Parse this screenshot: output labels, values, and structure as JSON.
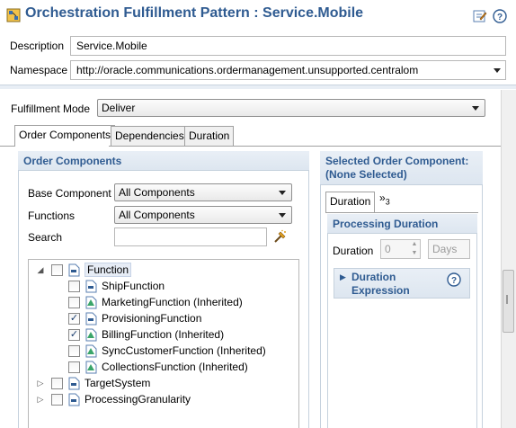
{
  "header": {
    "title": "Orchestration Fulfillment Pattern : Service.Mobile"
  },
  "form": {
    "description_label": "Description",
    "description_value": "Service.Mobile",
    "namespace_label": "Namespace",
    "namespace_value": "http://oracle.communications.ordermanagement.unsupported.centralom"
  },
  "fulfillment_mode": {
    "label": "Fulfillment Mode",
    "value": "Deliver"
  },
  "tabs": [
    {
      "label": "Order Components"
    },
    {
      "label": "Dependencies"
    },
    {
      "label": "Duration"
    }
  ],
  "order_components": {
    "heading": "Order Components",
    "base_component_label": "Base Component",
    "base_component_value": "All Components",
    "functions_label": "Functions",
    "functions_value": "All Components",
    "search_label": "Search",
    "tree": [
      {
        "label": "Function",
        "checked": false
      },
      {
        "label": "ShipFunction",
        "checked": false
      },
      {
        "label": "MarketingFunction (Inherited)",
        "checked": false
      },
      {
        "label": "ProvisioningFunction",
        "checked": true
      },
      {
        "label": "BillingFunction (Inherited)",
        "checked": true
      },
      {
        "label": "SyncCustomerFunction (Inherited)",
        "checked": false
      },
      {
        "label": "CollectionsFunction (Inherited)",
        "checked": false
      },
      {
        "label": "TargetSystem",
        "checked": false
      },
      {
        "label": "ProcessingGranularity",
        "checked": false
      }
    ]
  },
  "selected_component": {
    "heading_line1": "Selected Order Component:",
    "heading_line2": "(None Selected)",
    "tab_duration": "Duration",
    "tab_more": "»",
    "tab_more_count": "3",
    "processing_duration_heading": "Processing Duration",
    "duration_label": "Duration",
    "duration_value": "0",
    "duration_unit": "Days",
    "duration_expression_line1": "Duration",
    "duration_expression_line2": "Expression"
  },
  "colors": {
    "accent": "#2f5b91",
    "section_bg": "#dde6f0"
  }
}
